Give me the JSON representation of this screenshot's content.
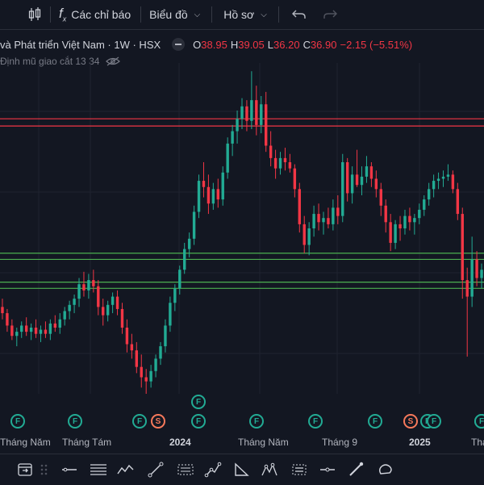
{
  "toolbar": {
    "indicators_label": "Các chỉ báo",
    "chart_label": "Biểu đồ",
    "profile_label": "Hồ sơ",
    "fx_symbol": "f"
  },
  "legend": {
    "title": "và Phát triển Việt Nam · 1W · HSX",
    "open_label": "O",
    "open": "38.95",
    "high_label": "H",
    "high": "39.05",
    "low_label": "L",
    "low": "36.20",
    "close_label": "C",
    "close": "36.90",
    "change": "−2.15 (−5.51%)",
    "sub_text": "Định mũ giao cắt 13 34",
    "colors": {
      "down": "#f23645",
      "up": "#22ab94",
      "resistance": "#f23645",
      "support": "#4caf50"
    }
  },
  "time_axis": [
    "Tháng Năm",
    "Tháng Tám",
    "2024",
    "Tháng Năm",
    "Tháng 9",
    "2025",
    "Thá"
  ],
  "events": [
    "F",
    "F",
    "F",
    "S",
    "F",
    "F",
    "F",
    "F",
    "F",
    "S",
    "F",
    "F",
    "F",
    "F"
  ],
  "chart_data": {
    "type": "candlestick",
    "series": [
      {
        "name": "",
        "candles": [
          [
            28.2,
            28.6,
            27.6,
            27.9
          ],
          [
            27.9,
            28.1,
            27.0,
            27.3
          ],
          [
            27.3,
            27.6,
            26.6,
            26.8
          ],
          [
            26.8,
            27.2,
            26.3,
            27.0
          ],
          [
            27.0,
            27.5,
            26.7,
            27.3
          ],
          [
            27.3,
            27.7,
            26.8,
            27.0
          ],
          [
            27.0,
            27.4,
            26.6,
            27.2
          ],
          [
            27.2,
            27.6,
            26.7,
            26.9
          ],
          [
            26.9,
            27.3,
            26.5,
            27.1
          ],
          [
            27.1,
            27.5,
            26.7,
            26.9
          ],
          [
            26.9,
            27.6,
            26.6,
            27.4
          ],
          [
            27.4,
            27.8,
            27.0,
            27.2
          ],
          [
            27.2,
            27.9,
            26.9,
            27.6
          ],
          [
            27.6,
            28.2,
            27.3,
            28.0
          ],
          [
            28.0,
            28.5,
            27.6,
            28.3
          ],
          [
            28.3,
            28.8,
            27.9,
            28.6
          ],
          [
            28.6,
            29.6,
            28.2,
            29.3
          ],
          [
            29.3,
            29.9,
            28.7,
            29.0
          ],
          [
            29.0,
            29.8,
            28.6,
            29.5
          ],
          [
            29.5,
            30.0,
            28.9,
            29.2
          ],
          [
            29.2,
            29.5,
            27.8,
            28.2
          ],
          [
            28.2,
            28.6,
            27.3,
            27.8
          ],
          [
            27.8,
            28.5,
            27.5,
            28.3
          ],
          [
            28.3,
            28.9,
            27.9,
            28.7
          ],
          [
            28.7,
            29.0,
            27.8,
            28.1
          ],
          [
            28.1,
            28.4,
            26.9,
            27.2
          ],
          [
            27.2,
            27.6,
            26.0,
            26.4
          ],
          [
            26.4,
            26.9,
            25.7,
            26.1
          ],
          [
            26.1,
            26.5,
            25.0,
            25.3
          ],
          [
            25.3,
            25.9,
            24.3,
            24.8
          ],
          [
            24.8,
            25.2,
            24.0,
            24.6
          ],
          [
            24.6,
            25.4,
            24.3,
            25.1
          ],
          [
            25.1,
            25.9,
            24.8,
            25.7
          ],
          [
            25.7,
            26.5,
            25.4,
            26.3
          ],
          [
            26.3,
            27.6,
            26.0,
            27.3
          ],
          [
            27.3,
            28.7,
            27.0,
            28.4
          ],
          [
            28.4,
            29.3,
            28.0,
            29.1
          ],
          [
            29.1,
            30.2,
            28.8,
            30.0
          ],
          [
            30.0,
            31.3,
            29.8,
            31.0
          ],
          [
            31.0,
            31.8,
            30.6,
            31.5
          ],
          [
            31.5,
            33.1,
            31.2,
            32.8
          ],
          [
            32.8,
            34.6,
            32.5,
            34.3
          ],
          [
            34.3,
            35.2,
            33.5,
            34.0
          ],
          [
            34.0,
            34.6,
            32.7,
            33.2
          ],
          [
            33.2,
            34.2,
            32.9,
            33.9
          ],
          [
            33.9,
            34.4,
            33.0,
            33.4
          ],
          [
            33.4,
            35.0,
            33.1,
            34.7
          ],
          [
            34.7,
            36.4,
            34.4,
            36.1
          ],
          [
            36.1,
            37.0,
            35.5,
            36.7
          ],
          [
            36.7,
            37.7,
            36.1,
            37.3
          ],
          [
            37.3,
            38.3,
            36.8,
            37.9
          ],
          [
            37.9,
            38.2,
            36.7,
            37.2
          ],
          [
            37.2,
            39.6,
            36.8,
            38.2
          ],
          [
            38.2,
            38.9,
            36.5,
            37.0
          ],
          [
            37.0,
            38.4,
            36.6,
            38.0
          ],
          [
            38.0,
            38.6,
            35.7,
            36.0
          ],
          [
            36.0,
            36.7,
            35.0,
            35.4
          ],
          [
            35.4,
            35.8,
            34.4,
            34.9
          ],
          [
            34.9,
            35.7,
            34.6,
            35.4
          ],
          [
            35.4,
            35.9,
            34.8,
            35.2
          ],
          [
            35.2,
            35.6,
            34.7,
            34.9
          ],
          [
            34.9,
            35.1,
            33.5,
            33.9
          ],
          [
            33.9,
            34.2,
            31.8,
            32.2
          ],
          [
            32.2,
            32.6,
            30.8,
            31.2
          ],
          [
            31.2,
            32.3,
            30.7,
            32.0
          ],
          [
            32.0,
            33.1,
            31.6,
            32.7
          ],
          [
            32.7,
            33.2,
            31.9,
            32.3
          ],
          [
            32.3,
            32.8,
            31.7,
            32.5
          ],
          [
            32.5,
            33.0,
            32.0,
            32.2
          ],
          [
            32.2,
            33.4,
            31.9,
            33.0
          ],
          [
            33.0,
            33.6,
            32.2,
            32.6
          ],
          [
            32.6,
            35.6,
            32.3,
            35.2
          ],
          [
            35.2,
            35.4,
            33.3,
            33.7
          ],
          [
            33.7,
            35.0,
            33.2,
            34.6
          ],
          [
            34.6,
            35.8,
            34.0,
            34.1
          ],
          [
            34.1,
            35.0,
            33.6,
            34.5
          ],
          [
            34.5,
            35.5,
            34.2,
            35.0
          ],
          [
            35.0,
            35.2,
            34.0,
            34.4
          ],
          [
            34.4,
            34.8,
            33.5,
            33.9
          ],
          [
            33.9,
            34.2,
            32.6,
            33.1
          ],
          [
            33.1,
            33.4,
            31.8,
            32.3
          ],
          [
            32.3,
            32.7,
            30.9,
            31.3
          ],
          [
            31.3,
            32.4,
            31.0,
            32.2
          ],
          [
            32.2,
            32.6,
            31.4,
            32.0
          ],
          [
            32.0,
            32.9,
            31.7,
            32.6
          ],
          [
            32.6,
            33.0,
            31.9,
            32.3
          ],
          [
            32.3,
            32.7,
            31.7,
            32.5
          ],
          [
            32.5,
            33.2,
            32.2,
            32.9
          ],
          [
            32.9,
            33.6,
            32.6,
            33.4
          ],
          [
            33.4,
            34.2,
            33.1,
            33.9
          ],
          [
            33.9,
            34.6,
            33.5,
            34.3
          ],
          [
            34.3,
            34.7,
            33.9,
            34.4
          ],
          [
            34.4,
            34.8,
            34.0,
            34.5
          ],
          [
            34.5,
            35.1,
            34.3,
            34.6
          ],
          [
            34.6,
            34.8,
            33.7,
            33.9
          ],
          [
            33.9,
            34.2,
            32.4,
            32.7
          ],
          [
            32.7,
            33.0,
            28.6,
            29.5
          ],
          [
            29.5,
            30.1,
            25.8,
            28.7
          ],
          [
            28.7,
            31.6,
            28.2,
            30.5
          ],
          [
            30.5,
            30.9,
            29.2,
            29.6
          ],
          [
            29.6,
            30.3,
            29.1,
            30.0
          ]
        ]
      }
    ],
    "y_range": [
      24.0,
      40.0
    ],
    "x_range": [
      -0.5,
      100.5
    ],
    "horizontal_lines": [
      {
        "value": 37.3,
        "color": "#f23645"
      },
      {
        "value": 36.95,
        "color": "#f23645"
      },
      {
        "value": 30.8,
        "color": "#4caf50"
      },
      {
        "value": 30.5,
        "color": "#4caf50"
      },
      {
        "value": 29.4,
        "color": "#4caf50"
      },
      {
        "value": 29.1,
        "color": "#4caf50"
      }
    ],
    "grid": true
  },
  "bottom_tools": [
    "calendar-range-icon",
    "grip-icon",
    "horizontal-line-icon",
    "parallel-channel-icon",
    "zigzag-icon",
    "trend-line-icon",
    "dotted-range-icon",
    "path-icon",
    "triangle-icon",
    "pattern-icon",
    "bars-pattern-icon",
    "ray-icon",
    "brush-icon",
    "rounded-rect-icon"
  ]
}
